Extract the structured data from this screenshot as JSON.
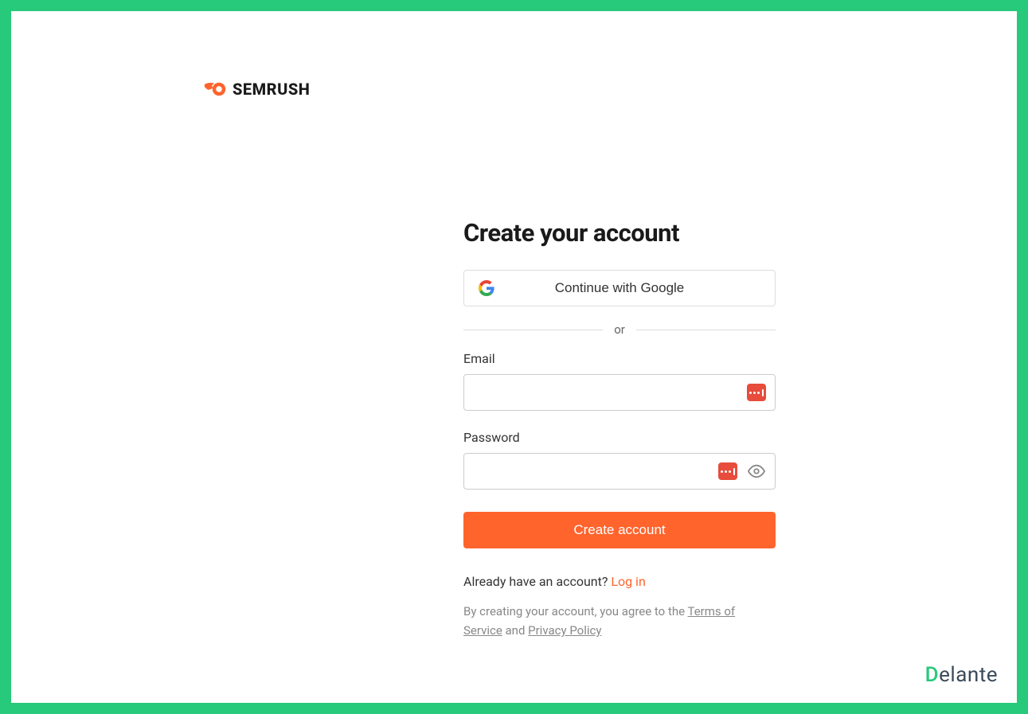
{
  "brand": {
    "logo_text": "SEMRUSH"
  },
  "form": {
    "heading": "Create your account",
    "google_button_label": "Continue with Google",
    "divider_text": "or",
    "email_label": "Email",
    "email_value": "",
    "password_label": "Password",
    "password_value": "",
    "submit_label": "Create account",
    "login_prompt": "Already have an account? ",
    "login_link": "Log in",
    "terms_prefix": "By creating your account, you agree to the ",
    "terms_of_service": "Terms of Service",
    "terms_and": " and ",
    "privacy_policy": "Privacy Policy"
  },
  "footer": {
    "delante_d": "D",
    "delante_rest": "elante"
  },
  "colors": {
    "accent_orange": "#ff642d",
    "frame_green": "#27c97a",
    "badge_red": "#e74c3c"
  }
}
